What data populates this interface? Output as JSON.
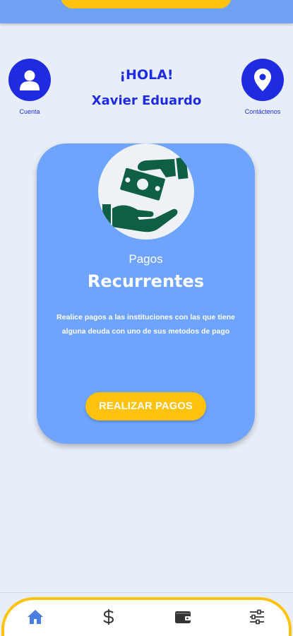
{
  "header": {
    "greeting": "¡HOLA!",
    "user_name": "Xavier Eduardo"
  },
  "side_buttons": {
    "left": {
      "label": "Cuenta",
      "icon": "user-icon"
    },
    "right": {
      "label": "Contáctenos",
      "icon": "location-pin-icon"
    }
  },
  "card": {
    "icon": "money-exchange-icon",
    "subtitle": "Pagos",
    "title": "Recurrentes",
    "description": "Realice pagos a las instituciones con las que tiene alguna deuda con uno de sus metodos de pago",
    "button_label": "REALIZAR PAGOS"
  },
  "bottom_nav": [
    {
      "name": "home",
      "icon": "home-icon",
      "active": true
    },
    {
      "name": "payments",
      "icon": "dollar-icon",
      "active": false
    },
    {
      "name": "wallet",
      "icon": "wallet-icon",
      "active": false
    },
    {
      "name": "settings",
      "icon": "sliders-icon",
      "active": false
    }
  ],
  "colors": {
    "primary_blue": "#1f2be0",
    "card_blue": "#6ea3ff",
    "accent_yellow": "#ffc20e",
    "nav_active": "#4a7fe0",
    "icon_green": "#0f5f45"
  }
}
